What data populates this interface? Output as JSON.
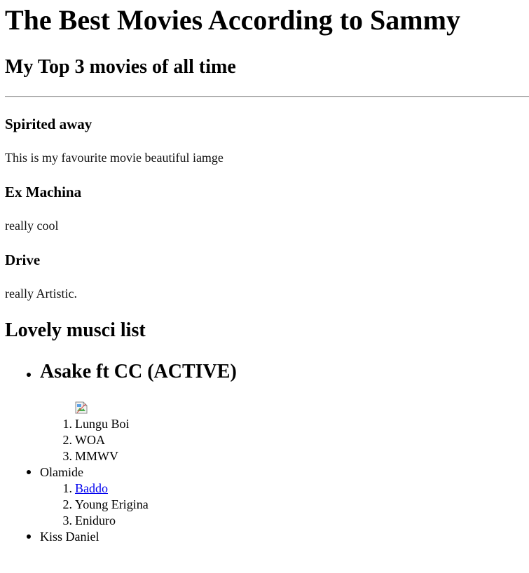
{
  "page": {
    "title": "The Best Movies According to Sammy",
    "subtitle": "My Top 3 movies of all time"
  },
  "movies": [
    {
      "title": "Spirited away",
      "description": "This is my favourite movie beautiful iamge"
    },
    {
      "title": "Ex Machina",
      "description": "really cool"
    },
    {
      "title": "Drive",
      "description": "really Artistic."
    }
  ],
  "music": {
    "heading": "Lovely musci list",
    "artists": [
      {
        "name": "Asake ft CC (ACTIVE)",
        "image_icon": "broken-image-icon",
        "songs": [
          {
            "number": "1.",
            "title": "Lungu Boi"
          },
          {
            "number": "2.",
            "title": "WOA"
          },
          {
            "number": "3.",
            "title": "MMWV"
          }
        ]
      },
      {
        "name": "Olamide",
        "songs": [
          {
            "number": "1.",
            "title": "Baddo",
            "link": true
          },
          {
            "number": "2.",
            "title": "Young Erigina"
          },
          {
            "number": "3.",
            "title": "Eniduro"
          }
        ]
      },
      {
        "name": "Kiss Daniel",
        "songs": []
      }
    ]
  },
  "colors": {
    "link": "#0000ee",
    "rule": "#9a9a9a"
  }
}
